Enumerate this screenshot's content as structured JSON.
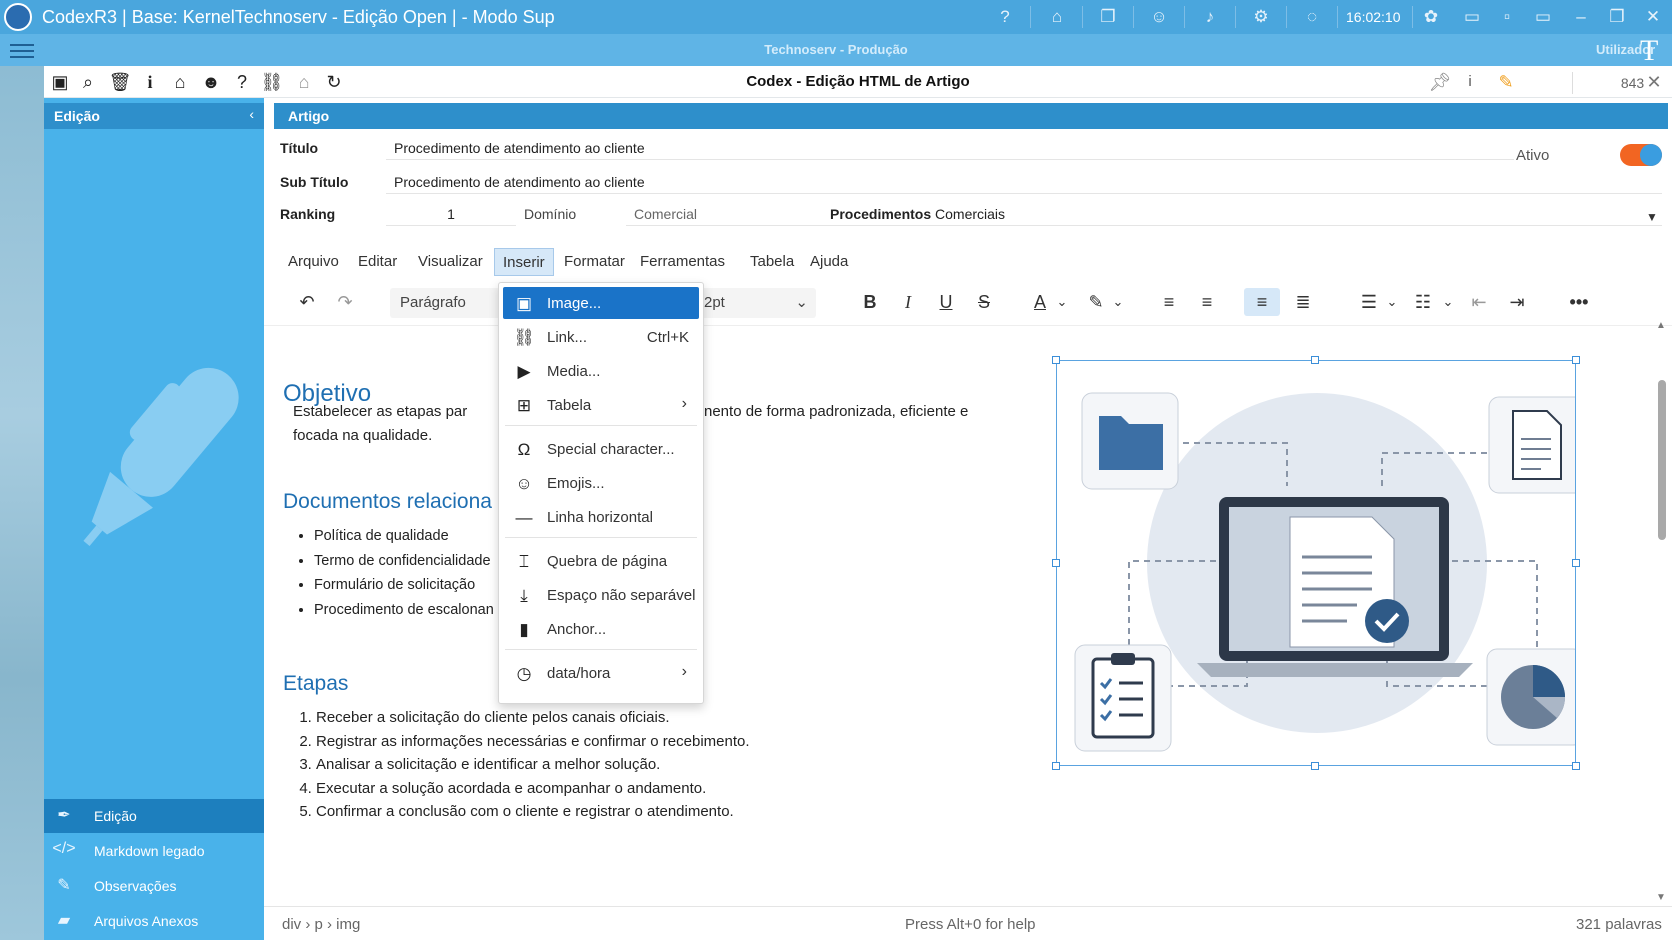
{
  "window": {
    "title": "CodexR3 | Base: KernelTechnoserv - Edição Open | - Modo Sup",
    "clock": "16:02:10"
  },
  "bar2": {
    "center": "Technoserv - Produção",
    "user": "Utilizador"
  },
  "toolbar": {
    "title": "Codex - Edição HTML de Artigo",
    "counter": "843"
  },
  "left_panel": {
    "header": "Edição",
    "nav": [
      {
        "label": "Edição",
        "icon": "pen-icon"
      },
      {
        "label": "Markdown legado",
        "icon": "code-icon"
      },
      {
        "label": "Observações",
        "icon": "pencil-icon"
      },
      {
        "label": "Arquivos Anexos",
        "icon": "folder-icon"
      }
    ]
  },
  "article": {
    "header": "Artigo",
    "titulo_label": "Título",
    "titulo_value": "Procedimento de atendimento ao cliente",
    "subtitulo_label": "Sub Título",
    "subtitulo_value": "Procedimento de atendimento ao cliente",
    "ranking_label": "Ranking",
    "ranking_value": "1",
    "dominio_label": "Domínio",
    "dominio_value": "Comercial",
    "categoria_bold": "Procedimentos",
    "categoria_rest": "Comerciais",
    "ativo_label": "Ativo",
    "ativo_on": true
  },
  "editor": {
    "menubar": [
      "Arquivo",
      "Editar",
      "Visualizar",
      "Inserir",
      "Formatar",
      "Ferramentas",
      "Tabela",
      "Ajuda"
    ],
    "active_menu": "Inserir",
    "block_format": "Parágrafo",
    "font_size": "2pt"
  },
  "insert_menu": [
    {
      "label": "Image...",
      "icon": "image-icon",
      "selected": true
    },
    {
      "label": "Link...",
      "icon": "link-icon",
      "shortcut": "Ctrl+K"
    },
    {
      "label": "Media...",
      "icon": "media-icon"
    },
    {
      "label": "Tabela",
      "icon": "table-icon",
      "submenu": true
    },
    {
      "label": "Special character...",
      "icon": "omega-icon"
    },
    {
      "label": "Emojis...",
      "icon": "emoji-icon"
    },
    {
      "label": "Linha horizontal",
      "icon": "hr-icon"
    },
    {
      "label": "Quebra de página",
      "icon": "page-break-icon"
    },
    {
      "label": "Espaço não separável",
      "icon": "nbsp-icon"
    },
    {
      "label": "Anchor...",
      "icon": "bookmark-icon"
    },
    {
      "label": "data/hora",
      "icon": "clock-icon",
      "submenu": true
    }
  ],
  "content": {
    "h_objetivo": "Objetivo",
    "objetivo_line1_left": "Estabelecer as etapas par",
    "objetivo_line1_right": "nento de forma padronizada, eficiente e",
    "objetivo_line2": "focada na qualidade.",
    "h_documentos": "Documentos relaciona",
    "documentos": [
      "Política de qualidade",
      "Termo de confidencialidade",
      "Formulário de solicitação",
      "Procedimento de escalonan"
    ],
    "h_etapas": "Etapas",
    "etapas": [
      "Receber a solicitação do cliente pelos canais oficiais.",
      "Registrar as informações necessárias e confirmar o recebimento.",
      "Analisar a solicitação e identificar a melhor solução.",
      "Executar a solução acordada e acompanhar o andamento.",
      "Confirmar a conclusão com o cliente e registrar o atendimento."
    ]
  },
  "status": {
    "path": "div › p › img",
    "help": "Press Alt+0 for help",
    "words": "321 palavras"
  },
  "colors": {
    "titlebar": "#4aa6dd",
    "panel": "#49b2ea",
    "header": "#2e8fcb",
    "heading": "#1f6fb2",
    "toggle": "#f26522",
    "selected": "#1a73c8"
  }
}
